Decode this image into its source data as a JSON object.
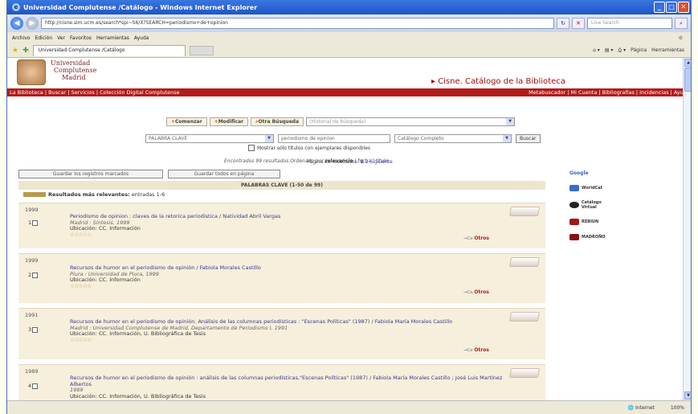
{
  "window": {
    "title": "Universidad Complutense /Catálogo - Windows Internet Explorer",
    "address": "http://cisne.sim.ucm.es/search*spi~S6/X?SEARCH=periodismo+de+opinion",
    "search_placeholder": "Live Search"
  },
  "menu": [
    "Archivo",
    "Edición",
    "Ver",
    "Favoritos",
    "Herramientas",
    "Ayuda"
  ],
  "tab": {
    "label": "Universidad Complutense /Catálogo",
    "pagina": "Página",
    "herramientas": "Herramientas"
  },
  "logo": {
    "line1": "Universidad",
    "line2": "Complutense",
    "line3": "Madrid"
  },
  "site_title": "▸ Cisne. Catálogo de la Biblioteca",
  "topnav": {
    "left": "La Biblioteca | Buscar | Servicios | Colección Digital Complutense",
    "right": "Metabuscador | Mi Cuenta | Bibliografías | Incidencias | Ayuda"
  },
  "buttons": {
    "comenzar": "Comenzar",
    "modificar": "Modificar",
    "otra": "Otra Búsqueda",
    "historial": "(Historial de búsqueda)"
  },
  "search": {
    "field": "PALABRA CLAVE",
    "query": "periodismo de opinion",
    "scope": "Catálogo Completo",
    "buscar": "Buscar",
    "checkbox_label": "Mostrar sólo títulos con ejemplares disponibles"
  },
  "found": {
    "prefix": "Encontrados 99 resultados.Ordenado por",
    "relevancia": "relevancia",
    "rest": "| fecha | título .",
    "pages_prefix": "Página de resultados:",
    "pages_current": "1",
    "pages_rest": "2 Siguiente"
  },
  "save": {
    "marked": "Guardar los registros marcados",
    "all": "Guardar todos en página"
  },
  "pk_bar": "PALABRAS CLAVE (1-50 de 99)",
  "relevant": {
    "label": "Resultados más relevantes:",
    "rest": "entradas 1-6"
  },
  "results": [
    {
      "year": "1999",
      "num": "1",
      "title": "Periodismo de opinion : claves de la retorica periodistica / Natividad Abril Vargas",
      "pub": "Madrid : Síntesis, 1999",
      "loc": "Ubicación: CC. Información",
      "stars": "☆☆☆☆☆",
      "otros": "Otros"
    },
    {
      "year": "1999",
      "num": "2",
      "title": "Recursos de humor en el periodismo de opinión / Fabiola Morales Castillo",
      "pub": "Piura : Universidad de Piura, 1999",
      "loc": "Ubicación: CC. Información",
      "stars": "☆☆☆☆☆",
      "otros": "Otros"
    },
    {
      "year": "1991",
      "num": "3",
      "title": "Recursos de humor en el periodismo de opinión. Análisis de las columnas periodísticas : \"Escenas Políticas\" (1987) / Fabiola María Morales Castillo",
      "pub": "Madrid : Universidad Complutense de Madrid, Departamento de Periodismo I, 1991",
      "loc": "Ubicación: CC. Información, U. Bibliográfica de Tesis",
      "stars": "☆☆☆☆☆",
      "otros": "Otros"
    },
    {
      "year": "1989",
      "num": "4",
      "title": "Recursos de humor en el periodismo de opinión : análisis de las columnas periodísticas,\"Escenas Políticas\" (1987) / Fabiola María Morales Castillo ; José Luis Martínez Albertos",
      "pub": "1989",
      "loc": "Ubicación: CC. Información, U. Bibliográfica de Tesis",
      "stars": "",
      "otros": ""
    }
  ],
  "right_links": [
    "Google",
    "WorldCat",
    "Catálogo Virtual",
    "REBIUN",
    "MADROÑO"
  ],
  "status": {
    "zone": "Internet",
    "zoom": "100%"
  }
}
